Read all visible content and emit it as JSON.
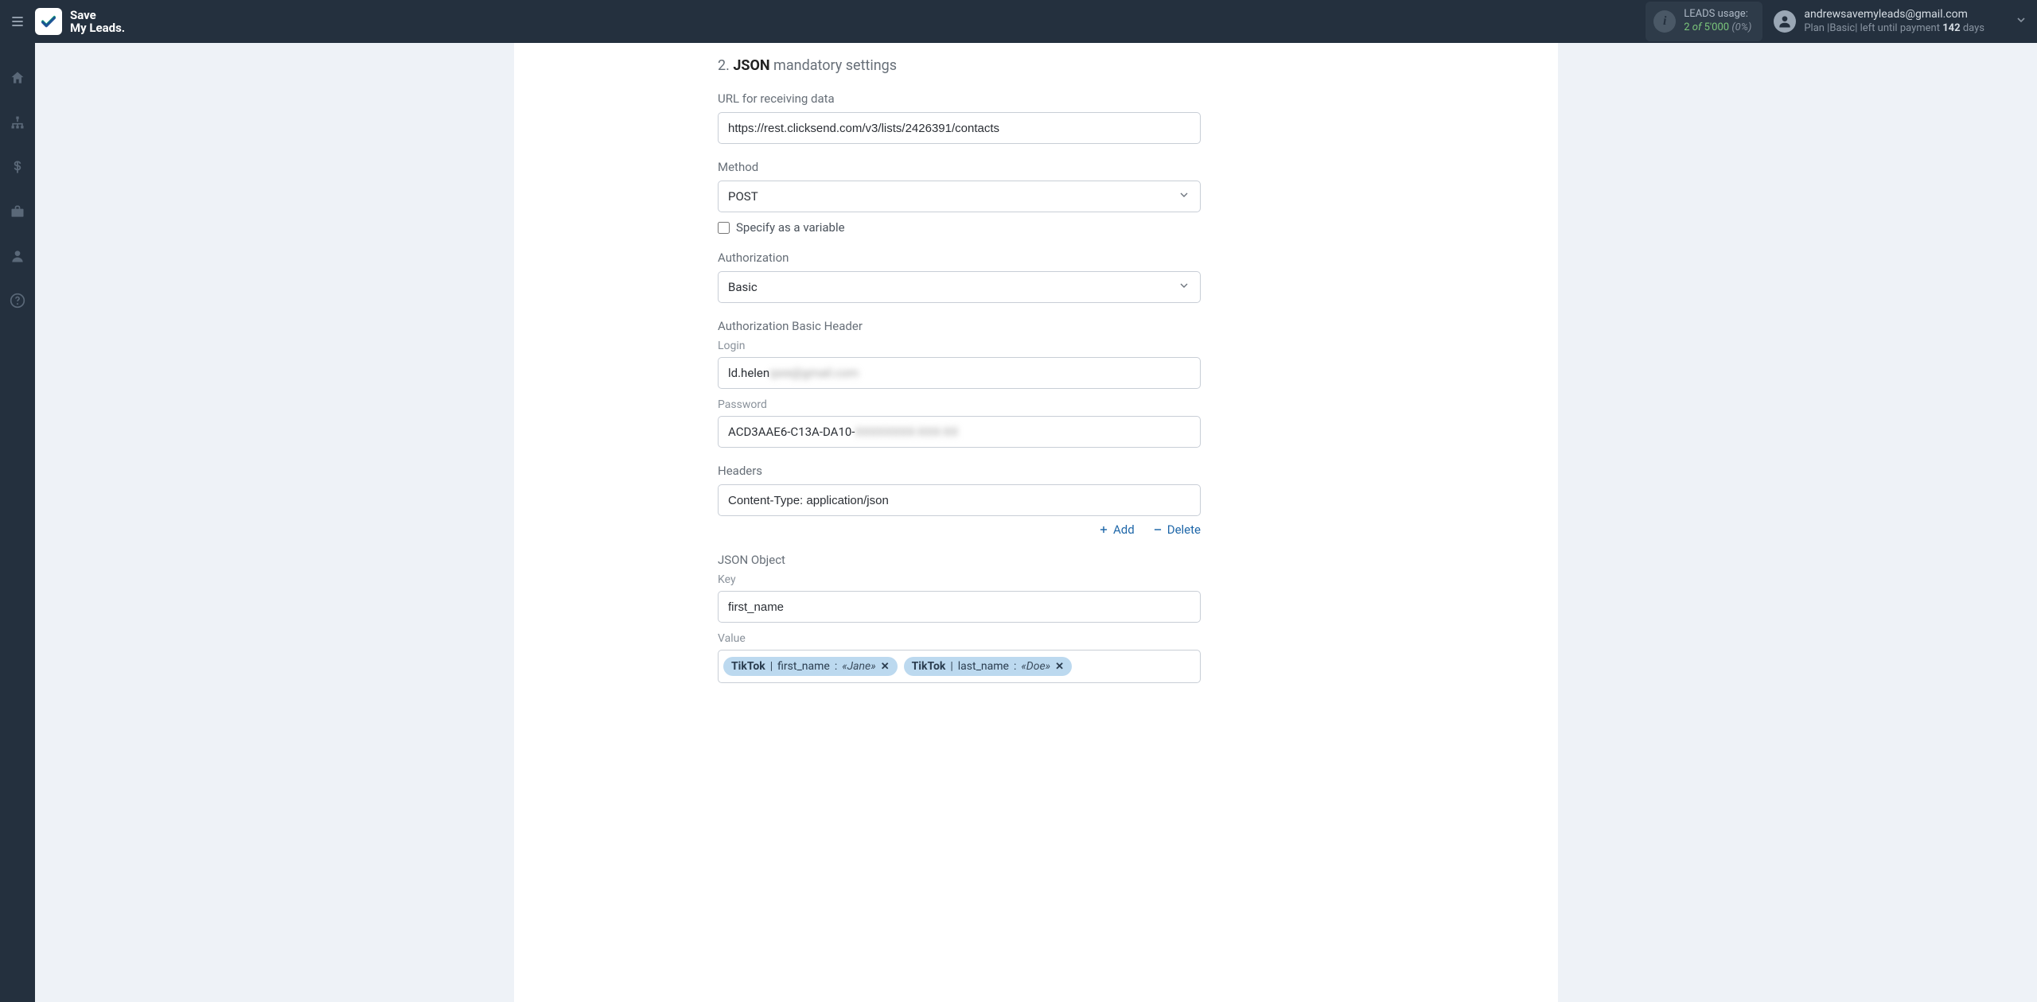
{
  "brand": {
    "line1": "Save",
    "line2": "My Leads."
  },
  "usage": {
    "title": "LEADS usage:",
    "used": "2",
    "of_word": "of",
    "total": "5'000",
    "pct": "(0%)"
  },
  "account": {
    "email": "andrewsavemyleads@gmail.com",
    "plan_prefix": "Plan |",
    "plan_name": "Basic",
    "plan_mid": "| left until payment ",
    "days": "142",
    "days_suffix": " days"
  },
  "section": {
    "num": "2.",
    "bold": "JSON",
    "rest": " mandatory settings"
  },
  "url": {
    "label": "URL for receiving data",
    "value": "https://rest.clicksend.com/v3/lists/2426391/contacts"
  },
  "method": {
    "label": "Method",
    "value": "POST",
    "checkbox": "Specify as a variable"
  },
  "authz": {
    "label": "Authorization",
    "value": "Basic"
  },
  "basic": {
    "label": "Authorization Basic Header",
    "login_label": "Login",
    "login_visible": "ld.helen",
    "login_blur": " qwe@gmail.com",
    "pw_label": "Password",
    "pw_visible": "ACD3AAE6-C13A-DA10-",
    "pw_blur": "XXXXXXXX-XXX-XX"
  },
  "headers": {
    "label": "Headers",
    "value": "Content-Type: application/json",
    "add": "Add",
    "delete": "Delete"
  },
  "jsonobj": {
    "label": "JSON Object",
    "key_label": "Key",
    "key_value": "first_name",
    "value_label": "Value"
  },
  "tokens": [
    {
      "src": "TikTok",
      "field": "first_name",
      "example": "«Jane»"
    },
    {
      "src": "TikTok",
      "field": "last_name",
      "example": "«Doe»"
    }
  ]
}
